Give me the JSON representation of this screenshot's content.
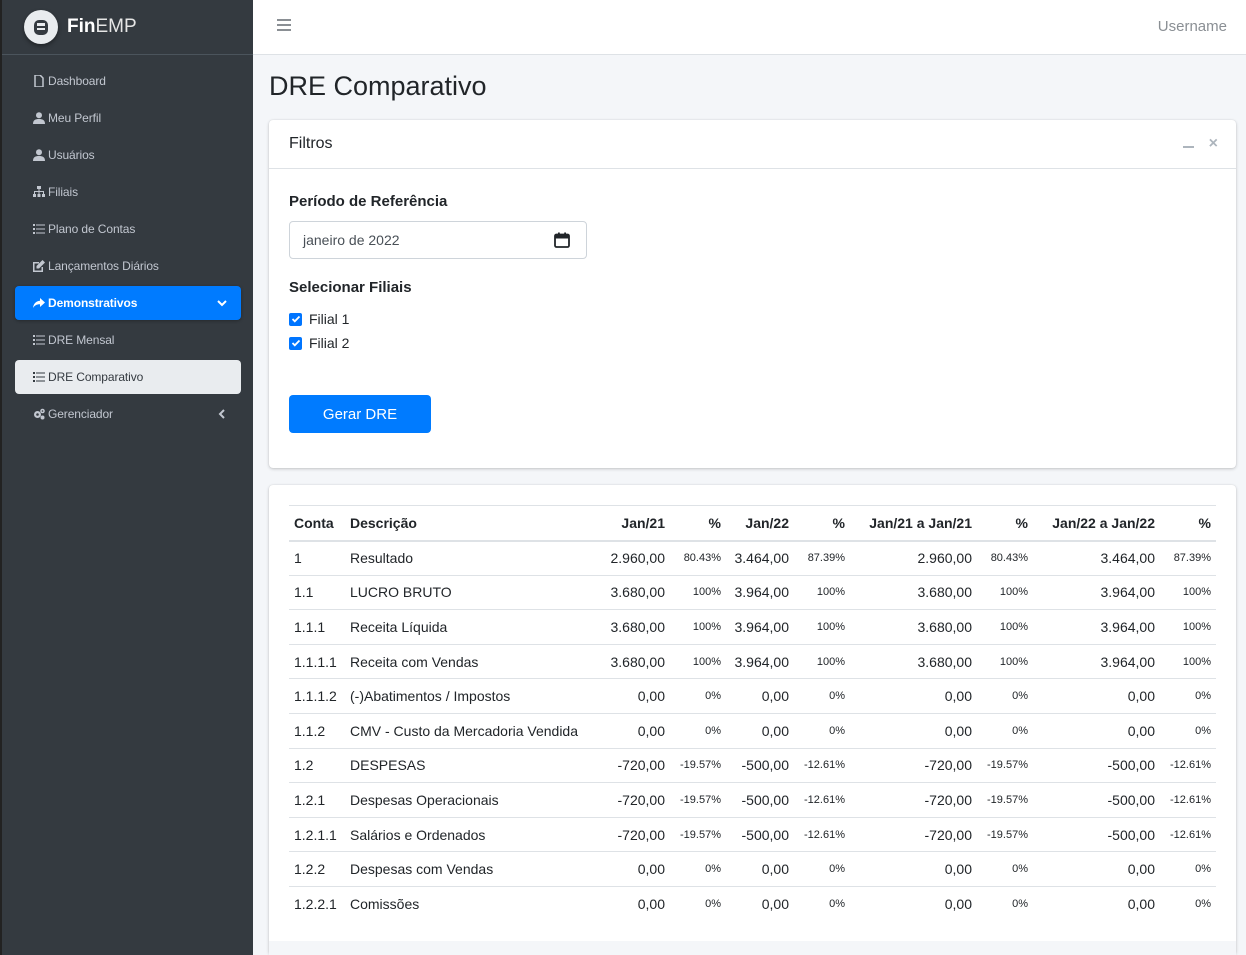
{
  "brand": {
    "name_bold": "Fin",
    "name_light": "EMP"
  },
  "header": {
    "username": "Username"
  },
  "sidebar": {
    "items": [
      {
        "label": "Dashboard",
        "icon": "file-icon"
      },
      {
        "label": "Meu Perfil",
        "icon": "user-icon"
      },
      {
        "label": "Usuários",
        "icon": "user-icon"
      },
      {
        "label": "Filiais",
        "icon": "sitemap-icon"
      },
      {
        "label": "Plano de Contas",
        "icon": "list-icon"
      },
      {
        "label": "Lançamentos Diários",
        "icon": "edit-icon"
      },
      {
        "label": "Demonstrativos",
        "icon": "share-icon"
      },
      {
        "label": "DRE Mensal",
        "icon": "list-icon"
      },
      {
        "label": "DRE Comparativo",
        "icon": "list-icon"
      },
      {
        "label": "Gerenciador",
        "icon": "cogs-icon"
      }
    ]
  },
  "page": {
    "title": "DRE Comparativo"
  },
  "filters": {
    "title": "Filtros",
    "period_label": "Período de Referência",
    "period_value": "janeiro de 2022",
    "branches_label": "Selecionar Filiais",
    "branches": [
      {
        "label": "Filial 1",
        "checked": true
      },
      {
        "label": "Filial 2",
        "checked": true
      }
    ],
    "submit_label": "Gerar DRE"
  },
  "table": {
    "headers": [
      "Conta",
      "Descrição",
      "Jan/21",
      "%",
      "Jan/22",
      "%",
      "Jan/21 a Jan/21",
      "%",
      "Jan/22 a Jan/22",
      "%"
    ],
    "rows": [
      [
        "1",
        "Resultado",
        "2.960,00",
        "80.43%",
        "3.464,00",
        "87.39%",
        "2.960,00",
        "80.43%",
        "3.464,00",
        "87.39%"
      ],
      [
        "1.1",
        "LUCRO BRUTO",
        "3.680,00",
        "100%",
        "3.964,00",
        "100%",
        "3.680,00",
        "100%",
        "3.964,00",
        "100%"
      ],
      [
        "1.1.1",
        "Receita Líquida",
        "3.680,00",
        "100%",
        "3.964,00",
        "100%",
        "3.680,00",
        "100%",
        "3.964,00",
        "100%"
      ],
      [
        "1.1.1.1",
        "Receita com Vendas",
        "3.680,00",
        "100%",
        "3.964,00",
        "100%",
        "3.680,00",
        "100%",
        "3.964,00",
        "100%"
      ],
      [
        "1.1.1.2",
        "(-)Abatimentos / Impostos",
        "0,00",
        "0%",
        "0,00",
        "0%",
        "0,00",
        "0%",
        "0,00",
        "0%"
      ],
      [
        "1.1.2",
        "CMV - Custo da Mercadoria Vendida",
        "0,00",
        "0%",
        "0,00",
        "0%",
        "0,00",
        "0%",
        "0,00",
        "0%"
      ],
      [
        "1.2",
        "DESPESAS",
        "-720,00",
        "-19.57%",
        "-500,00",
        "-12.61%",
        "-720,00",
        "-19.57%",
        "-500,00",
        "-12.61%"
      ],
      [
        "1.2.1",
        "Despesas Operacionais",
        "-720,00",
        "-19.57%",
        "-500,00",
        "-12.61%",
        "-720,00",
        "-19.57%",
        "-500,00",
        "-12.61%"
      ],
      [
        "1.2.1.1",
        "Salários e Ordenados",
        "-720,00",
        "-19.57%",
        "-500,00",
        "-12.61%",
        "-720,00",
        "-19.57%",
        "-500,00",
        "-12.61%"
      ],
      [
        "1.2.2",
        "Despesas com Vendas",
        "0,00",
        "0%",
        "0,00",
        "0%",
        "0,00",
        "0%",
        "0,00",
        "0%"
      ],
      [
        "1.2.2.1",
        "Comissões",
        "0,00",
        "0%",
        "0,00",
        "0%",
        "0,00",
        "0%",
        "0,00",
        "0%"
      ]
    ]
  },
  "colors": {
    "primary": "#007bff",
    "sidebar_bg": "#343a40",
    "sidebar_text": "#c2c7d0"
  }
}
